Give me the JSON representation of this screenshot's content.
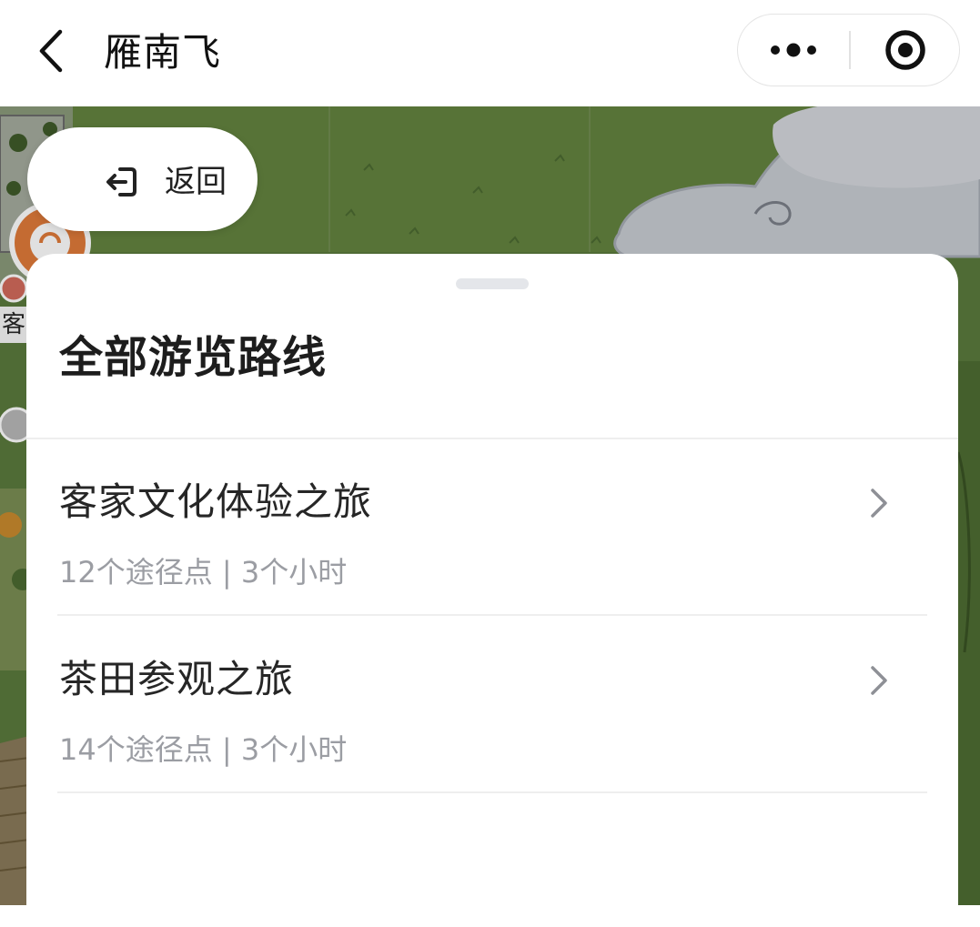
{
  "navbar": {
    "title": "雁南飞",
    "back_icon": "chevron-left-icon",
    "more_icon": "more-dots-icon",
    "close_icon": "target-close-icon"
  },
  "map": {
    "partial_label": "客"
  },
  "return_button": {
    "label": "返回",
    "icon": "exit-arrow-icon"
  },
  "sheet": {
    "title": "全部游览路线",
    "routes": [
      {
        "name": "客家文化体验之旅",
        "meta": "12个途径点 | 3个小时"
      },
      {
        "name": "茶田参观之旅",
        "meta": "14个途径点 | 3个小时"
      }
    ]
  },
  "colors": {
    "map_grass": "#5b7a3d",
    "map_cloud": "#c8ccd2",
    "meta_text": "#9b9da3",
    "divider": "#eeeeee"
  }
}
